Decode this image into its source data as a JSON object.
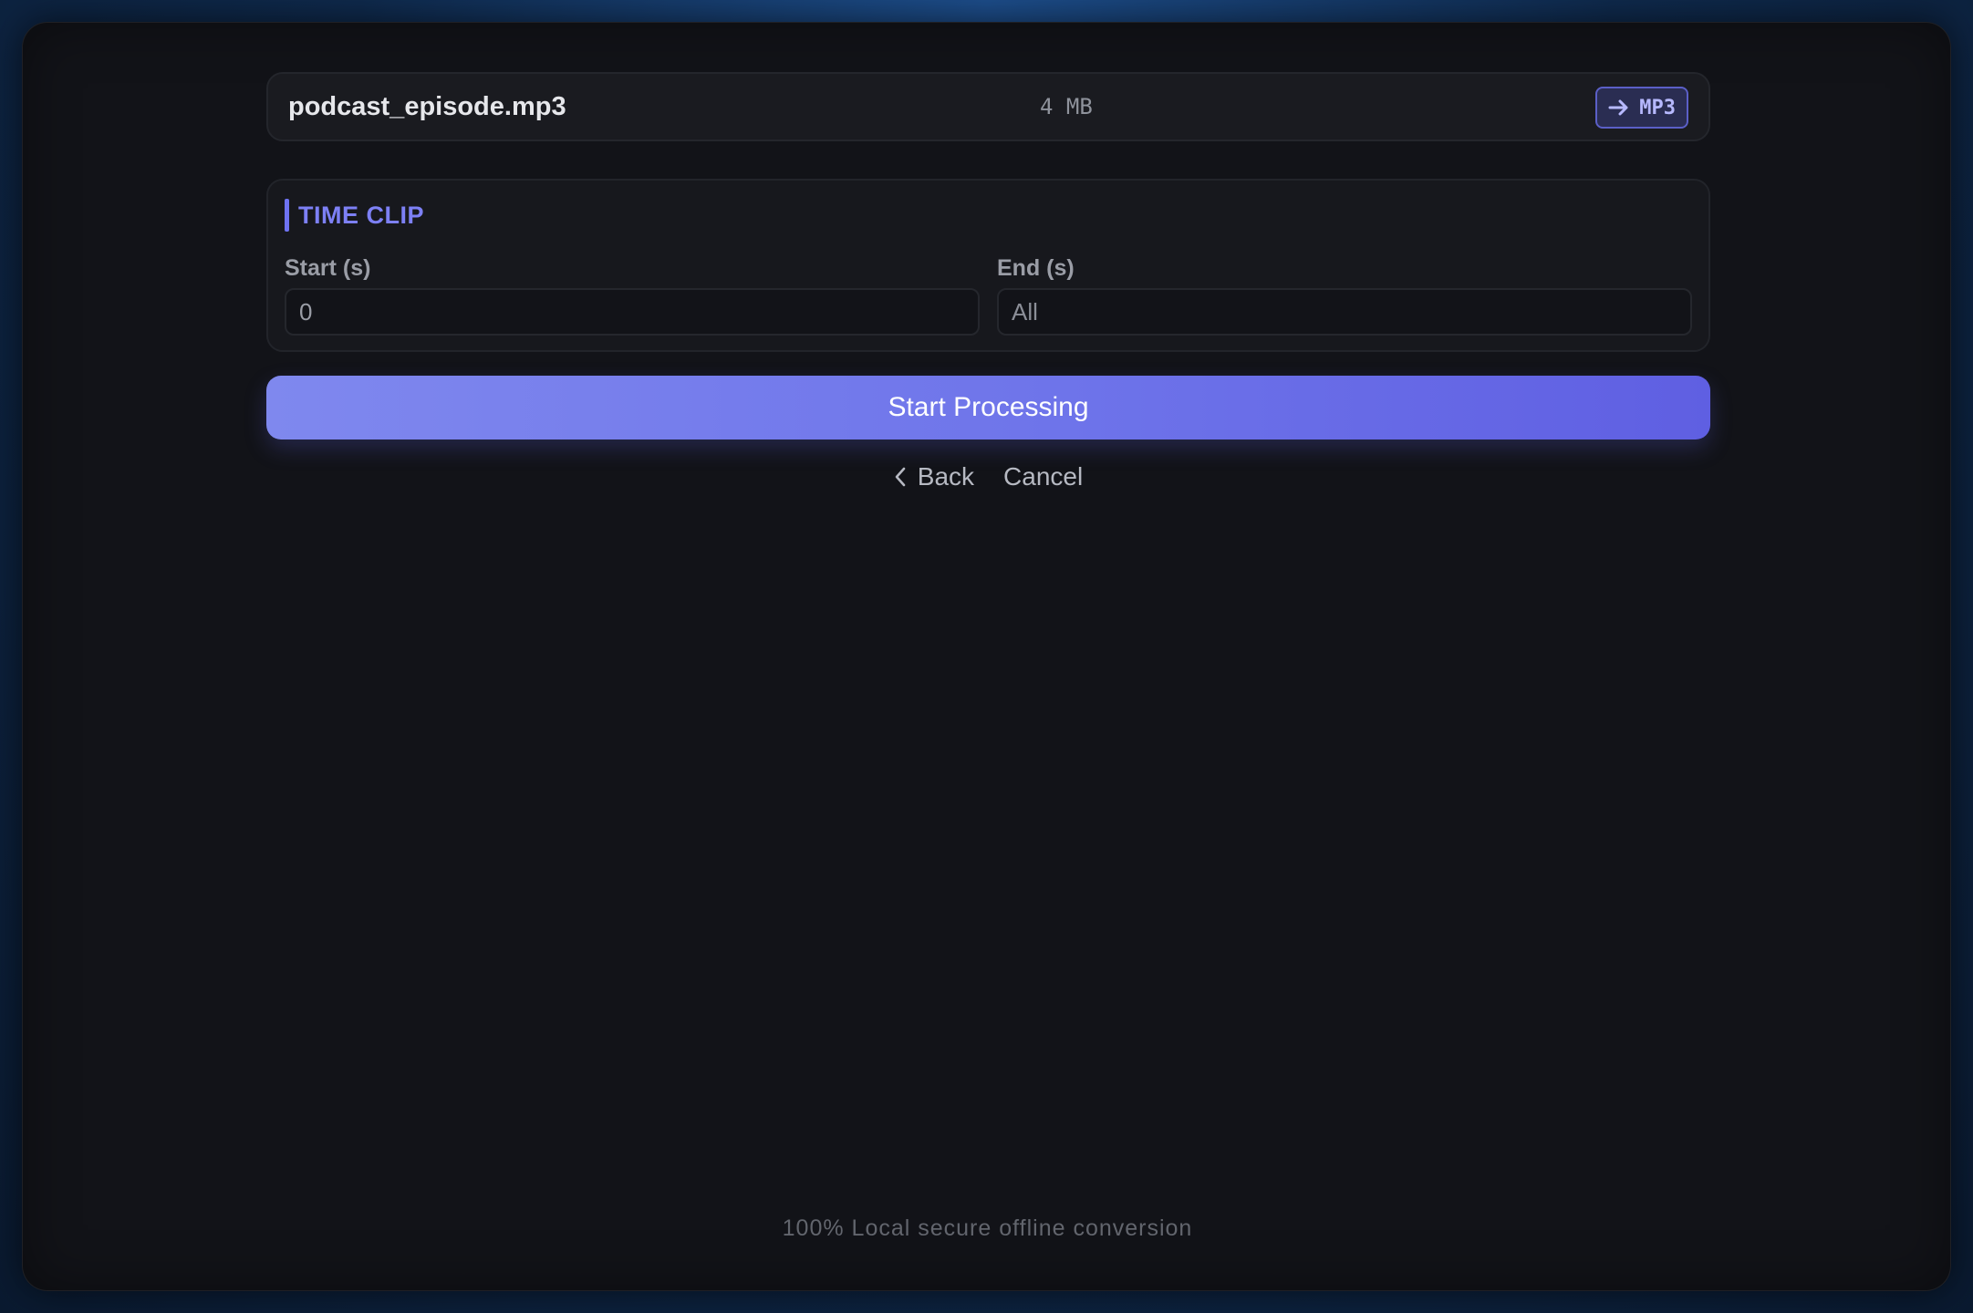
{
  "file": {
    "name": "podcast_episode.mp3",
    "size": "4 MB",
    "target_format": "MP3",
    "target_icon": "arrow-right-icon"
  },
  "time_clip": {
    "title": "TIME CLIP",
    "start_label": "Start (s)",
    "start_value": "0",
    "end_label": "End (s)",
    "end_placeholder": "All"
  },
  "actions": {
    "start_label": "Start Processing",
    "back_label": "Back",
    "back_icon": "chevron-left-icon",
    "cancel_label": "Cancel"
  },
  "footer": {
    "note": "100% Local secure offline conversion"
  },
  "colors": {
    "accent": "#6e72f2",
    "button_gradient_start": "#7f88ee",
    "button_gradient_end": "#5f5fe2",
    "panel_bg": "#121318"
  }
}
